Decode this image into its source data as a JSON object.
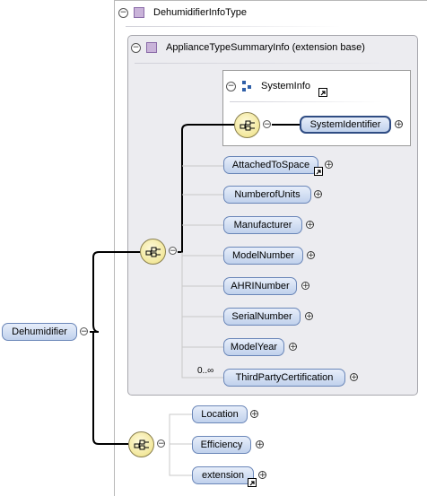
{
  "root": {
    "label": "Dehumidifier"
  },
  "type": {
    "label": "DehumidifierInfoType"
  },
  "base": {
    "label": "ApplianceTypeSummaryInfo (extension base)"
  },
  "system_info": {
    "label": "SystemInfo"
  },
  "elements": [
    {
      "label": "SystemIdentifier",
      "ref": false
    },
    {
      "label": "AttachedToSpace",
      "ref": true
    },
    {
      "label": "NumberofUnits",
      "ref": false
    },
    {
      "label": "Manufacturer",
      "ref": false
    },
    {
      "label": "ModelNumber",
      "ref": false
    },
    {
      "label": "AHRINumber",
      "ref": false
    },
    {
      "label": "SerialNumber",
      "ref": false
    },
    {
      "label": "ModelYear",
      "ref": false
    },
    {
      "label": "ThirdPartyCertification",
      "ref": false,
      "cardinality": "0..∞"
    }
  ],
  "type_elements": [
    {
      "label": "Location",
      "ref": false
    },
    {
      "label": "Efficiency",
      "ref": false
    },
    {
      "label": "extension",
      "ref": true
    }
  ],
  "symbols": {
    "collapse": "−",
    "expand": "+"
  },
  "colors": {
    "element_fill_top": "#e7eefa",
    "element_fill_bottom": "#c0d1ec",
    "element_border": "#6a86b8",
    "compositor_fill": "#f2e79a",
    "base_panel": "#ececf0",
    "wire": "#000000"
  }
}
